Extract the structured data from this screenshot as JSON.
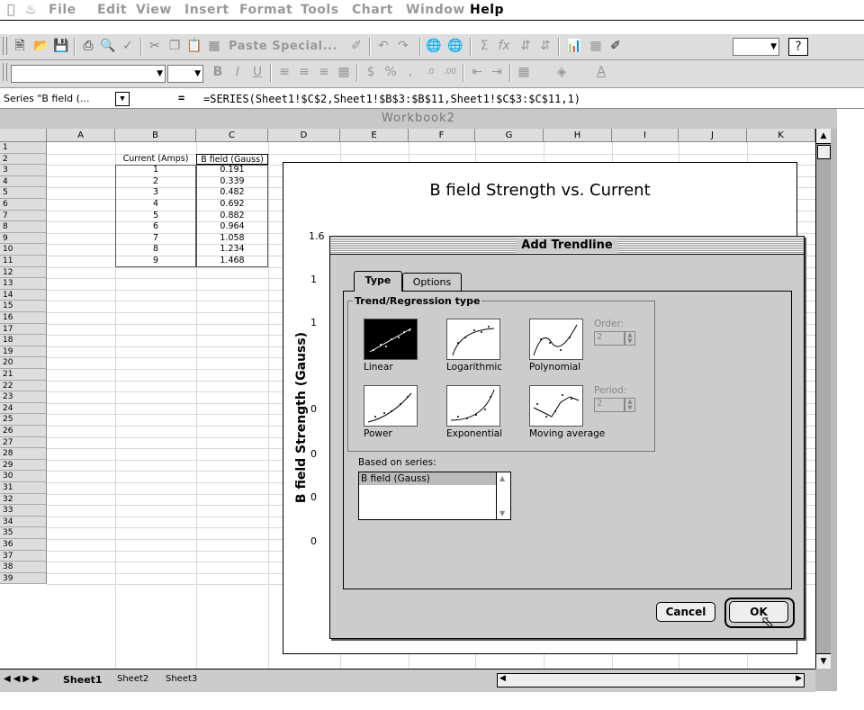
{
  "menubar": {
    "items": [
      "File",
      "Edit",
      "View",
      "Insert",
      "Format",
      "Tools",
      "Chart",
      "Window",
      "Help"
    ]
  },
  "toolbar": {
    "paste_special": "Paste Special...",
    "sigma": "Σ",
    "fx": "fx"
  },
  "formula_bar": {
    "name_box": "Series \"B field (...",
    "equals": "=",
    "formula": "=SERIES(Sheet1!$C$2,Sheet1!$B$3:$B$11,Sheet1!$C$3:$C$11,1)"
  },
  "window": {
    "title": "Workbook2"
  },
  "sheet": {
    "columns": [
      "A",
      "B",
      "C",
      "D",
      "E",
      "F",
      "G",
      "H",
      "I",
      "J",
      "K"
    ],
    "rows": [
      "1",
      "2",
      "3",
      "4",
      "5",
      "6",
      "7",
      "8",
      "9",
      "10",
      "11",
      "12",
      "13",
      "14",
      "15",
      "16",
      "17",
      "18",
      "19",
      "20",
      "21",
      "22",
      "23",
      "24",
      "25",
      "26",
      "27",
      "28",
      "29",
      "30",
      "31",
      "32",
      "33",
      "34",
      "35",
      "36",
      "37",
      "38",
      "39"
    ],
    "header_b": "Current (Amps)",
    "header_c": "B field (Gauss)",
    "data": [
      [
        "1",
        "0.191"
      ],
      [
        "2",
        "0.339"
      ],
      [
        "3",
        "0.482"
      ],
      [
        "4",
        "0.692"
      ],
      [
        "5",
        "0.882"
      ],
      [
        "6",
        "0.964"
      ],
      [
        "7",
        "1.058"
      ],
      [
        "8",
        "1.234"
      ],
      [
        "9",
        "1.468"
      ]
    ],
    "tabs": [
      "Sheet1",
      "Sheet2",
      "Sheet3"
    ]
  },
  "chart": {
    "title": "B field Strength vs. Current",
    "ylabel": "B field Strength (Gauss)",
    "visible_ticks": [
      "1.6",
      "1",
      "1",
      "0",
      "0",
      "0",
      "0"
    ]
  },
  "dialog": {
    "title": "Add Trendline",
    "tabs": [
      "Type",
      "Options"
    ],
    "group_label": "Trend/Regression type",
    "types": [
      "Linear",
      "Logarithmic",
      "Polynomial",
      "Power",
      "Exponential",
      "Moving average"
    ],
    "order_label": "Order:",
    "order_value": "2",
    "period_label": "Period:",
    "period_value": "2",
    "based_on_label": "Based on series:",
    "series": [
      "B field (Gauss)"
    ],
    "cancel": "Cancel",
    "ok": "OK"
  }
}
